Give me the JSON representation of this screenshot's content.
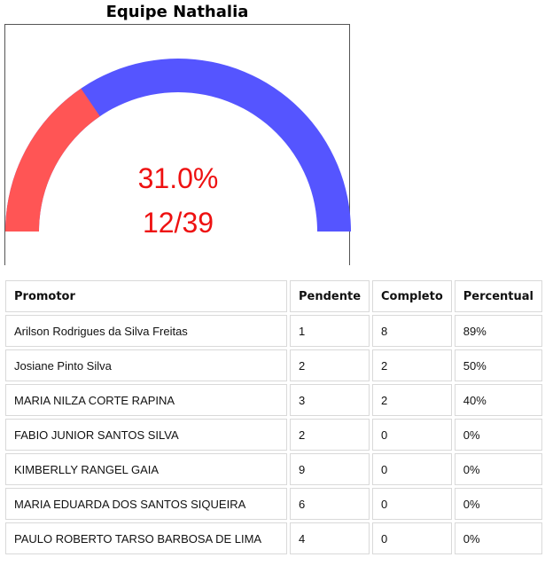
{
  "title": "Equipe Nathalia",
  "gauge": {
    "percent_label": "31.0%",
    "count_label": "12/39",
    "value_fraction": 0.31,
    "colors": {
      "filled": "#ff5555",
      "remaining": "#5555ff",
      "text": "#ee1111"
    }
  },
  "table": {
    "headers": [
      "Promotor",
      "Pendente",
      "Completo",
      "Percentual"
    ],
    "rows": [
      [
        "Arilson Rodrigues da Silva Freitas",
        "1",
        "8",
        "89%"
      ],
      [
        "Josiane Pinto Silva",
        "2",
        "2",
        "50%"
      ],
      [
        "MARIA NILZA CORTE RAPINA",
        "3",
        "2",
        "40%"
      ],
      [
        "FABIO JUNIOR SANTOS SILVA",
        "2",
        "0",
        "0%"
      ],
      [
        "KIMBERLLY RANGEL GAIA",
        "9",
        "0",
        "0%"
      ],
      [
        "MARIA EDUARDA DOS SANTOS SIQUEIRA",
        "6",
        "0",
        "0%"
      ],
      [
        "PAULO ROBERTO TARSO BARBOSA DE LIMA",
        "4",
        "0",
        "0%"
      ]
    ]
  }
}
